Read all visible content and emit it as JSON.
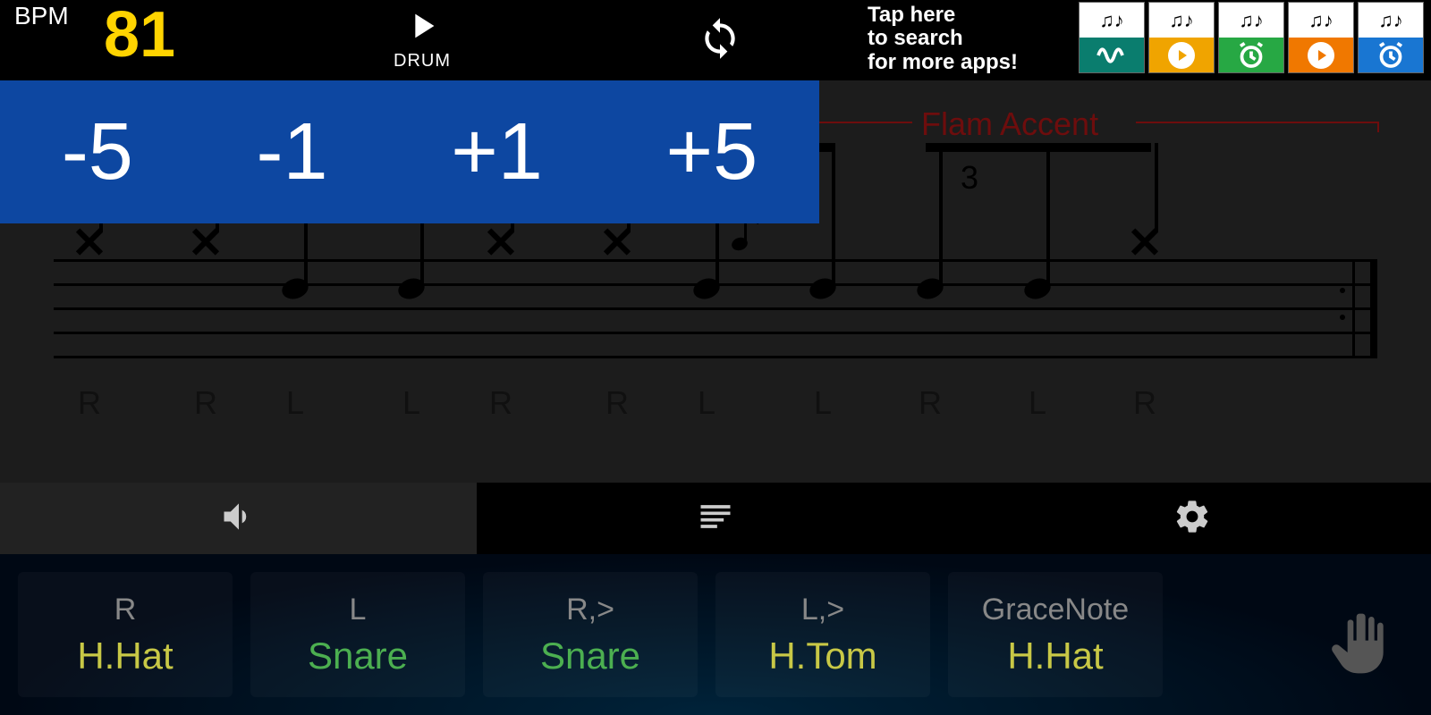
{
  "topbar": {
    "bpm_label": "BPM",
    "bpm_value": "81",
    "play_label": "DRUM",
    "ad_text": "Tap here\nto search\nfor more apps!"
  },
  "bpm_popup": {
    "b1": "-5",
    "b2": "-1",
    "b3": "+1",
    "b4": "+5"
  },
  "notation": {
    "section_title": "Flam Accent",
    "triplet": "3",
    "accent": ">",
    "sticking": [
      "R",
      "R",
      "L",
      "L",
      "R",
      "R",
      "L",
      "L",
      "R",
      "L",
      "R"
    ]
  },
  "app_icons": [
    {
      "color": "#0a7d6e",
      "type": "wave"
    },
    {
      "color": "#f0a400",
      "type": "play"
    },
    {
      "color": "#27a844",
      "type": "clock"
    },
    {
      "color": "#f07800",
      "type": "play"
    },
    {
      "color": "#1976d2",
      "type": "clock"
    }
  ],
  "pads": [
    {
      "top": "R",
      "bot": "H.Hat",
      "cls": "yellow"
    },
    {
      "top": "L",
      "bot": "Snare",
      "cls": "green"
    },
    {
      "top": "R,>",
      "bot": "Snare",
      "cls": "green"
    },
    {
      "top": "L,>",
      "bot": "H.Tom",
      "cls": "yellow"
    },
    {
      "top": "GraceNote",
      "bot": "H.Hat",
      "cls": "yellow"
    }
  ]
}
